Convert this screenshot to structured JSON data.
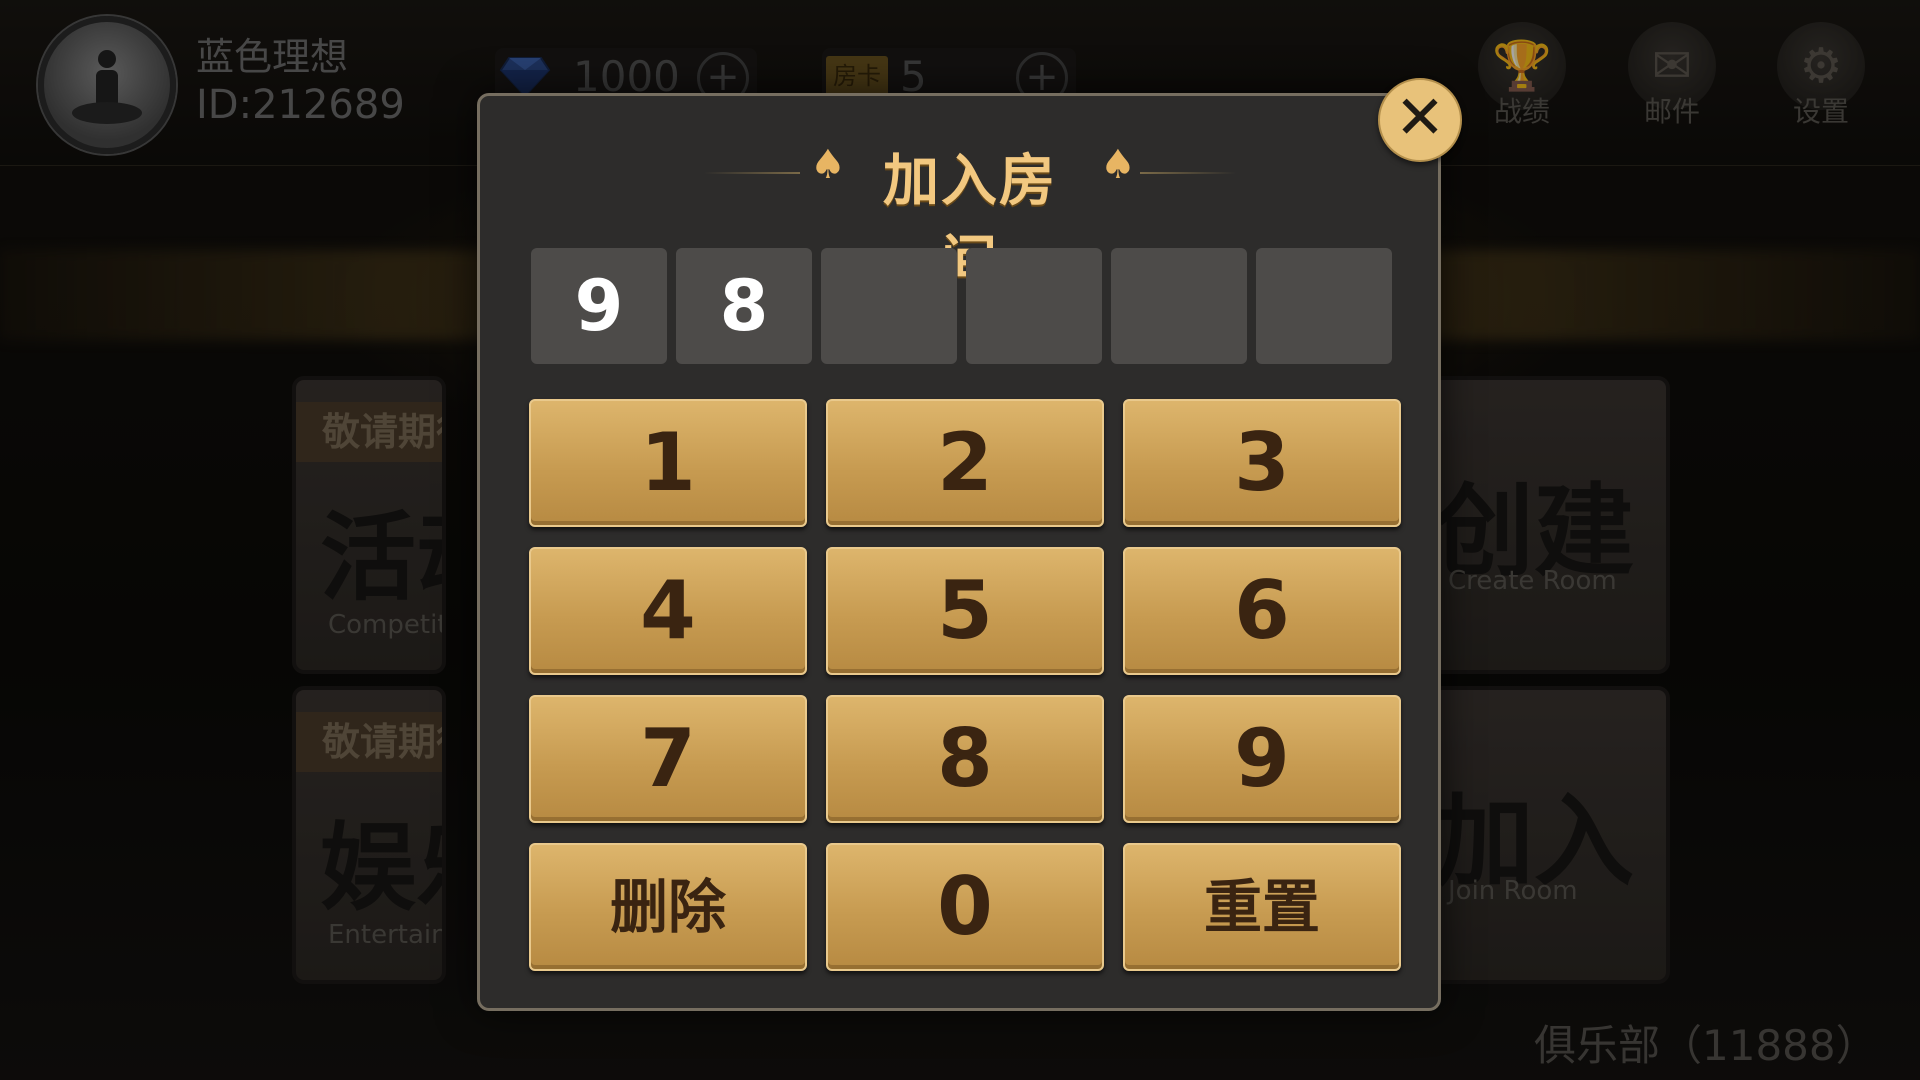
{
  "user": {
    "name": "蓝色理想",
    "id_text": "ID:212689"
  },
  "resources": {
    "diamond": {
      "value": "1000",
      "icon": "diamond-icon",
      "plus": "+"
    },
    "room_card": {
      "label": "房卡",
      "value": "5",
      "plus": "+"
    }
  },
  "top_icons": [
    {
      "label": "战绩",
      "icon": "trophy-icon",
      "glyph": "🏆"
    },
    {
      "label": "邮件",
      "icon": "mail-icon",
      "glyph": "✉"
    },
    {
      "label": "设置",
      "icon": "gear-icon",
      "glyph": "⚙"
    }
  ],
  "tiles": {
    "activity": {
      "badge": "敬请期待",
      "title": "活动",
      "subtitle": "Competition"
    },
    "entertainment": {
      "badge": "敬请期待",
      "title": "娱乐",
      "subtitle": "Entertainment"
    },
    "create": {
      "title": "创建",
      "subtitle": "Create Room"
    },
    "join": {
      "title": "加入",
      "subtitle": "Join Room"
    }
  },
  "club_label": "俱乐部（11888）",
  "modal": {
    "title": "加入房间",
    "spade": "♠",
    "close": "✕",
    "entered_digits": [
      "9",
      "8",
      "",
      "",
      "",
      ""
    ],
    "keys": [
      "1",
      "2",
      "3",
      "4",
      "5",
      "6",
      "7",
      "8",
      "9",
      "删除",
      "0",
      "重置"
    ]
  },
  "colors": {
    "accent_gold": "#e8c27a",
    "key_gold": "#c79b51",
    "modal_bg": "#2d2c2b"
  }
}
